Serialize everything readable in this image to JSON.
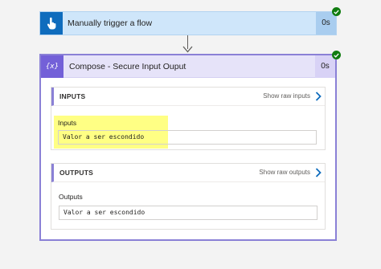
{
  "trigger": {
    "title": "Manually trigger a flow",
    "duration": "0s",
    "icon": "hand-pointer-icon",
    "status": "succeeded"
  },
  "compose": {
    "title": "Compose - Secure Input Ouput",
    "duration": "0s",
    "icon": "curly-braces-icon",
    "status": "succeeded",
    "inputs_section": {
      "title": "INPUTS",
      "show_raw": "Show raw inputs",
      "field_label": "Inputs",
      "field_value": "Valor a ser escondido"
    },
    "outputs_section": {
      "title": "OUTPUTS",
      "show_raw": "Show raw outputs",
      "field_label": "Outputs",
      "field_value": "Valor a ser escondido"
    }
  },
  "colors": {
    "trigger_accent": "#0f6cbd",
    "compose_accent": "#7360d8",
    "success": "#107c10",
    "highlight": "#ffff6e"
  }
}
